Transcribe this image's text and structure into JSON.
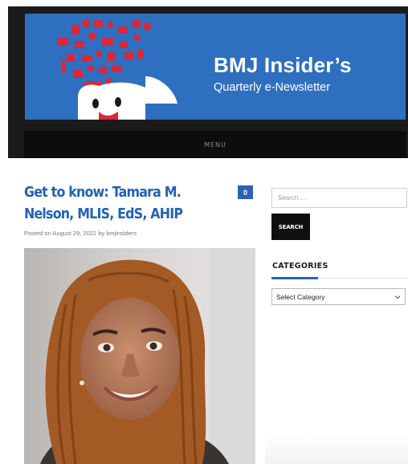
{
  "banner": {
    "title": "BMJ Insider’s",
    "subtitle": "Quarterly e-Newsletter"
  },
  "nav": {
    "menu_label": "MENU"
  },
  "post": {
    "title": "Get to know: Tamara M. Nelson, MLIS, EdS, AHIP",
    "comment_count": "0",
    "meta_posted_on": "Posted on",
    "meta_date": "August 29, 2022",
    "meta_by": "by",
    "meta_author": "bmjinsiders"
  },
  "sidebar": {
    "search_placeholder": "Search ...",
    "search_button": "SEARCH",
    "categories_title": "CATEGORIES",
    "category_select_value": "Select Category"
  },
  "colors": {
    "banner_blue": "#2f6fc0",
    "title_blue": "#1f63b5",
    "accent_blue": "#2a63b3",
    "mascot_red": "#d8283a",
    "dark": "#0d0d0d"
  }
}
